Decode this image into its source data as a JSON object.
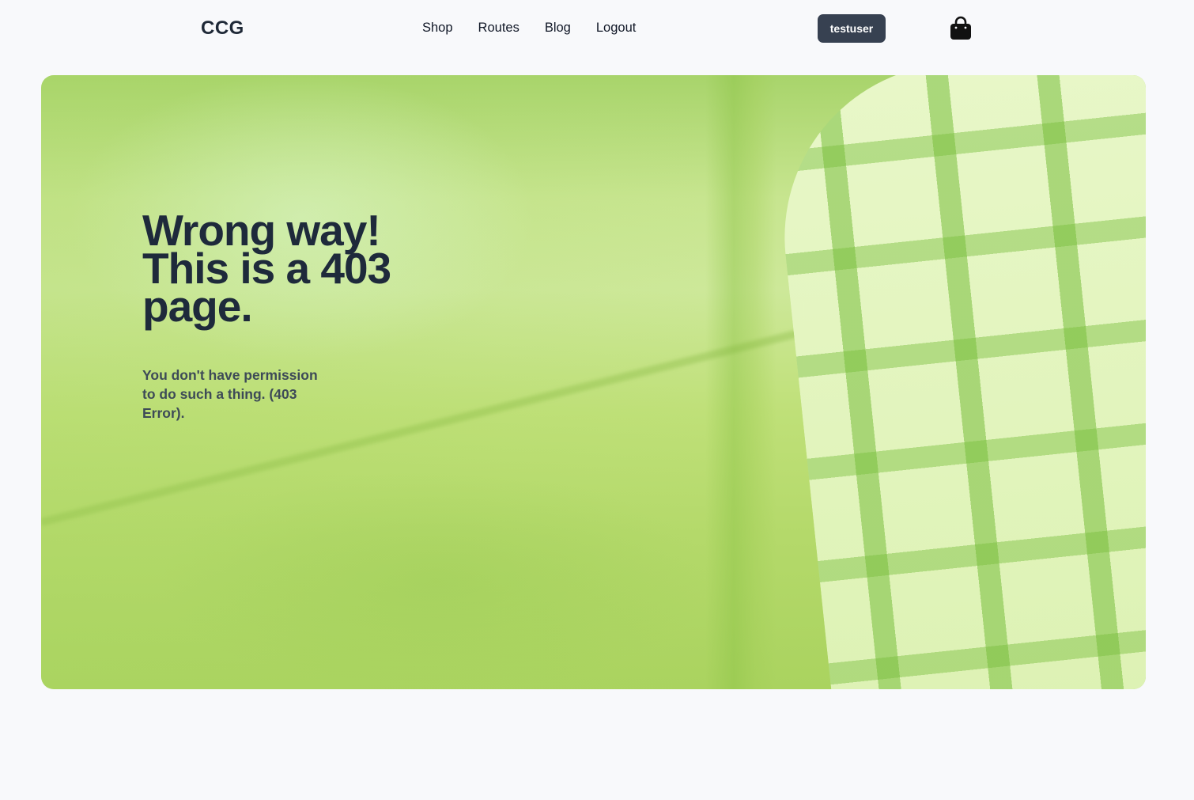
{
  "header": {
    "logo": "CCG",
    "nav": [
      "Shop",
      "Routes",
      "Blog",
      "Logout"
    ],
    "user_label": "testuser",
    "cart_icon": "shopping-bag-icon"
  },
  "hero": {
    "headline": "Wrong way! This is a 403 page.",
    "message": "You don't have permission to do such a thing. (403 Error)."
  },
  "colors": {
    "page_bg": "#f8f9fb",
    "text_dark": "#1e2a3b",
    "button_bg": "#374151",
    "hero_tint": "#b4d96a"
  }
}
